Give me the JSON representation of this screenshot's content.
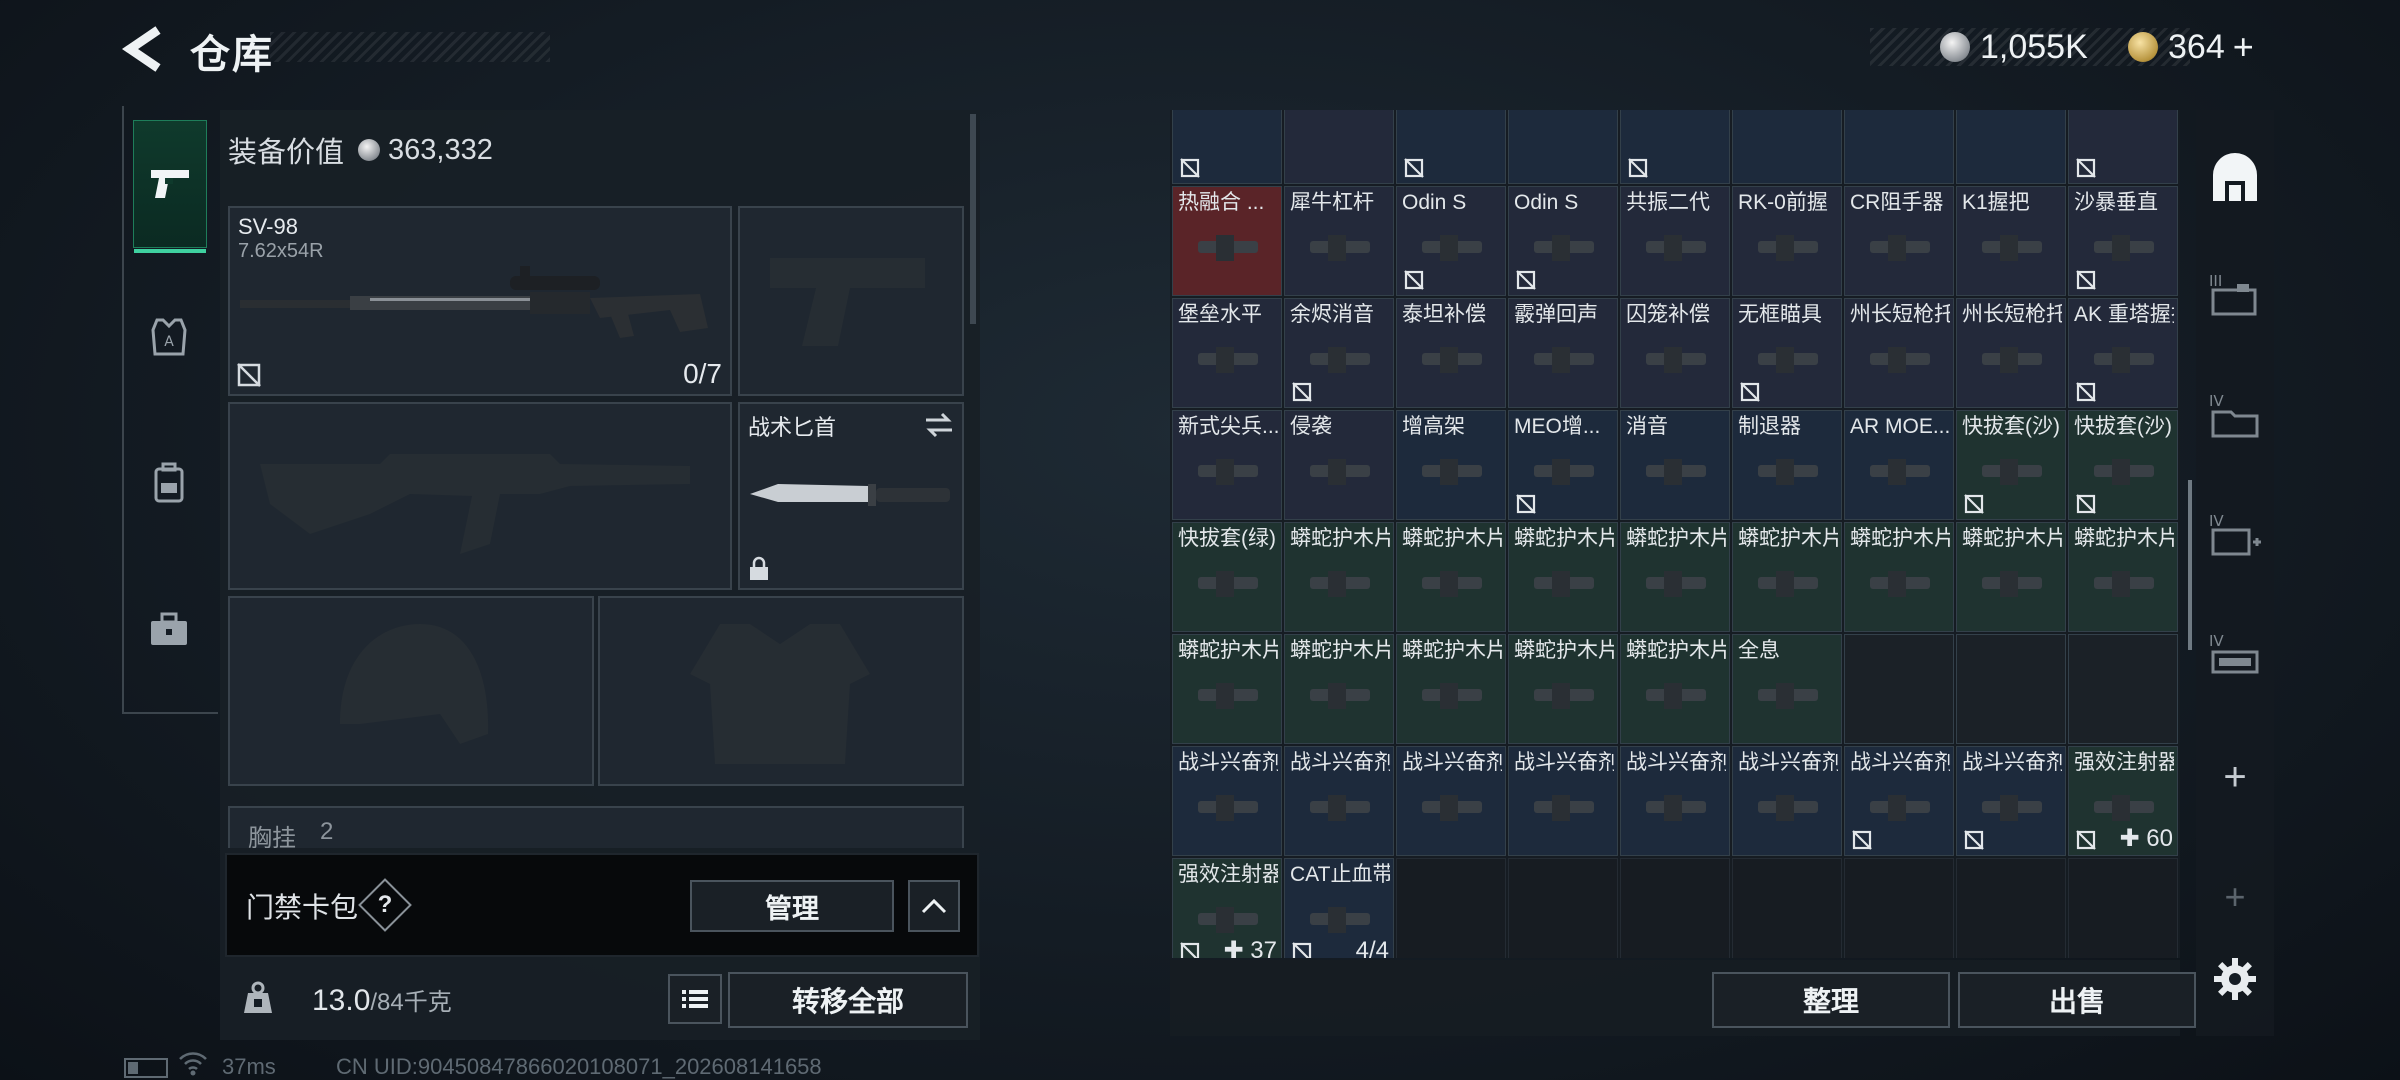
{
  "header": {
    "title": "仓库",
    "silver_amount": "1,055K",
    "gold_amount": "364",
    "gold_plus": "+"
  },
  "left": {
    "equip_value_label": "装备价值",
    "equip_value": "363,332",
    "primary_weapon": {
      "name": "SV-98",
      "caliber": "7.62x54R",
      "ammo": "0/7"
    },
    "knife_label": "战术匕首",
    "chest_label": "胸挂",
    "chest_count": "2",
    "keycard_label": "门禁卡包",
    "help_label": "?",
    "manage_label": "管理",
    "weight_current": "13.0",
    "weight_max": "/84千克",
    "transfer_all_label": "转移全部"
  },
  "stash": {
    "rows": [
      [
        {
          "name": "",
          "color": "c-blue",
          "lock": true
        },
        {
          "name": "",
          "color": "c-slate",
          "lock": false
        },
        {
          "name": "",
          "color": "c-blue",
          "lock": true
        },
        {
          "name": "",
          "color": "c-blue",
          "lock": false
        },
        {
          "name": "",
          "color": "c-blue",
          "lock": true
        },
        {
          "name": "",
          "color": "c-blue",
          "lock": false
        },
        {
          "name": "",
          "color": "c-blue",
          "lock": false
        },
        {
          "name": "",
          "color": "c-blue",
          "lock": false
        },
        {
          "name": "",
          "color": "c-slate",
          "lock": true
        }
      ],
      [
        {
          "name": "热融合 ...",
          "color": "c-red",
          "lock": false
        },
        {
          "name": "犀牛杠杆",
          "color": "c-slate",
          "lock": false
        },
        {
          "name": "Odin S",
          "color": "c-slate",
          "lock": true
        },
        {
          "name": "Odin S",
          "color": "c-slate",
          "lock": true
        },
        {
          "name": "共振二代",
          "color": "c-slate",
          "lock": false
        },
        {
          "name": "RK-0前握",
          "color": "c-slate",
          "lock": false
        },
        {
          "name": "CR阻手器",
          "color": "c-slate",
          "lock": false
        },
        {
          "name": "K1握把",
          "color": "c-slate",
          "lock": false
        },
        {
          "name": "沙暴垂直",
          "color": "c-slate",
          "lock": true
        }
      ],
      [
        {
          "name": "堡垒水平",
          "color": "c-slate",
          "lock": false
        },
        {
          "name": "余烬消音",
          "color": "c-slate",
          "lock": true
        },
        {
          "name": "泰坦补偿",
          "color": "c-slate",
          "lock": false
        },
        {
          "name": "霰弹回声",
          "color": "c-slate",
          "lock": false
        },
        {
          "name": "囚笼补偿",
          "color": "c-slate",
          "lock": false
        },
        {
          "name": "无框瞄具",
          "color": "c-slate",
          "lock": true
        },
        {
          "name": "州长短枪托",
          "color": "c-slate",
          "lock": false
        },
        {
          "name": "州长短枪托",
          "color": "c-slate",
          "lock": false
        },
        {
          "name": "AK 重塔握把",
          "color": "c-slate",
          "lock": true
        }
      ],
      [
        {
          "name": "新式尖兵...",
          "color": "c-slate",
          "lock": false
        },
        {
          "name": "侵袭",
          "color": "c-slate",
          "lock": false
        },
        {
          "name": "增高架",
          "color": "c-blue",
          "lock": false
        },
        {
          "name": "MEO增...",
          "color": "c-blue",
          "lock": true
        },
        {
          "name": "消音",
          "color": "c-blue",
          "lock": false
        },
        {
          "name": "制退器",
          "color": "c-blue",
          "lock": false
        },
        {
          "name": "AR MOE...",
          "color": "c-blue",
          "lock": false
        },
        {
          "name": "快拔套(沙)",
          "color": "c-teal",
          "lock": true
        },
        {
          "name": "快拔套(沙)",
          "color": "c-teal",
          "lock": true
        }
      ],
      [
        {
          "name": "快拔套(绿)",
          "color": "c-teal",
          "lock": false
        },
        {
          "name": "蟒蛇护木片",
          "color": "c-teal",
          "lock": false
        },
        {
          "name": "蟒蛇护木片",
          "color": "c-teal",
          "lock": false
        },
        {
          "name": "蟒蛇护木片",
          "color": "c-teal",
          "lock": false
        },
        {
          "name": "蟒蛇护木片",
          "color": "c-teal",
          "lock": false
        },
        {
          "name": "蟒蛇护木片",
          "color": "c-teal",
          "lock": false
        },
        {
          "name": "蟒蛇护木片",
          "color": "c-teal",
          "lock": false
        },
        {
          "name": "蟒蛇护木片",
          "color": "c-teal",
          "lock": false
        },
        {
          "name": "蟒蛇护木片",
          "color": "c-teal",
          "lock": false
        }
      ],
      [
        {
          "name": "蟒蛇护木片",
          "color": "c-teal",
          "lock": false
        },
        {
          "name": "蟒蛇护木片",
          "color": "c-teal",
          "lock": false
        },
        {
          "name": "蟒蛇护木片",
          "color": "c-teal",
          "lock": false
        },
        {
          "name": "蟒蛇护木片",
          "color": "c-teal",
          "lock": false
        },
        {
          "name": "蟒蛇护木片",
          "color": "c-teal",
          "lock": false
        },
        {
          "name": "全息",
          "color": "c-teal",
          "lock": false
        },
        {
          "name": "",
          "color": "c-gray",
          "lock": false
        },
        {
          "name": "",
          "color": "c-gray",
          "lock": false
        },
        {
          "name": "",
          "color": "c-gray",
          "lock": false
        }
      ],
      [
        {
          "name": "战斗兴奋剂",
          "color": "c-blue",
          "lock": false
        },
        {
          "name": "战斗兴奋剂",
          "color": "c-blue",
          "lock": false
        },
        {
          "name": "战斗兴奋剂",
          "color": "c-blue",
          "lock": false
        },
        {
          "name": "战斗兴奋剂",
          "color": "c-blue",
          "lock": false
        },
        {
          "name": "战斗兴奋剂",
          "color": "c-blue",
          "lock": false
        },
        {
          "name": "战斗兴奋剂",
          "color": "c-blue",
          "lock": false
        },
        {
          "name": "战斗兴奋剂",
          "color": "c-blue",
          "lock": true
        },
        {
          "name": "战斗兴奋剂",
          "color": "c-blue",
          "lock": true
        },
        {
          "name": "强效注射器",
          "color": "c-teal",
          "lock": true,
          "qty": "✚ 60"
        }
      ],
      [
        {
          "name": "强效注射器",
          "color": "c-teal",
          "lock": true,
          "qty": "✚ 37"
        },
        {
          "name": "CAT止血带",
          "color": "c-blue",
          "lock": true,
          "qty": "4/4"
        },
        {
          "name": "",
          "color": "c-empty",
          "lock": false
        },
        {
          "name": "",
          "color": "c-empty",
          "lock": false
        },
        {
          "name": "",
          "color": "c-empty",
          "lock": false
        },
        {
          "name": "",
          "color": "c-empty",
          "lock": false
        },
        {
          "name": "",
          "color": "c-empty",
          "lock": false
        },
        {
          "name": "",
          "color": "c-empty",
          "lock": false
        },
        {
          "name": "",
          "color": "c-empty",
          "lock": false
        }
      ]
    ],
    "sort_label": "整理",
    "sell_label": "出售"
  },
  "sidebar": {
    "items": [
      {
        "icon": "stash-tab-icon"
      },
      {
        "icon": "container-iii-icon"
      },
      {
        "icon": "container-iv-folder-icon"
      },
      {
        "icon": "container-iv-medkit-icon"
      },
      {
        "icon": "container-iv-crate-icon"
      }
    ],
    "add_label": "+"
  },
  "status": {
    "ping": "37ms",
    "uid": "CN UID:904508478660201080​71_202608141658"
  }
}
